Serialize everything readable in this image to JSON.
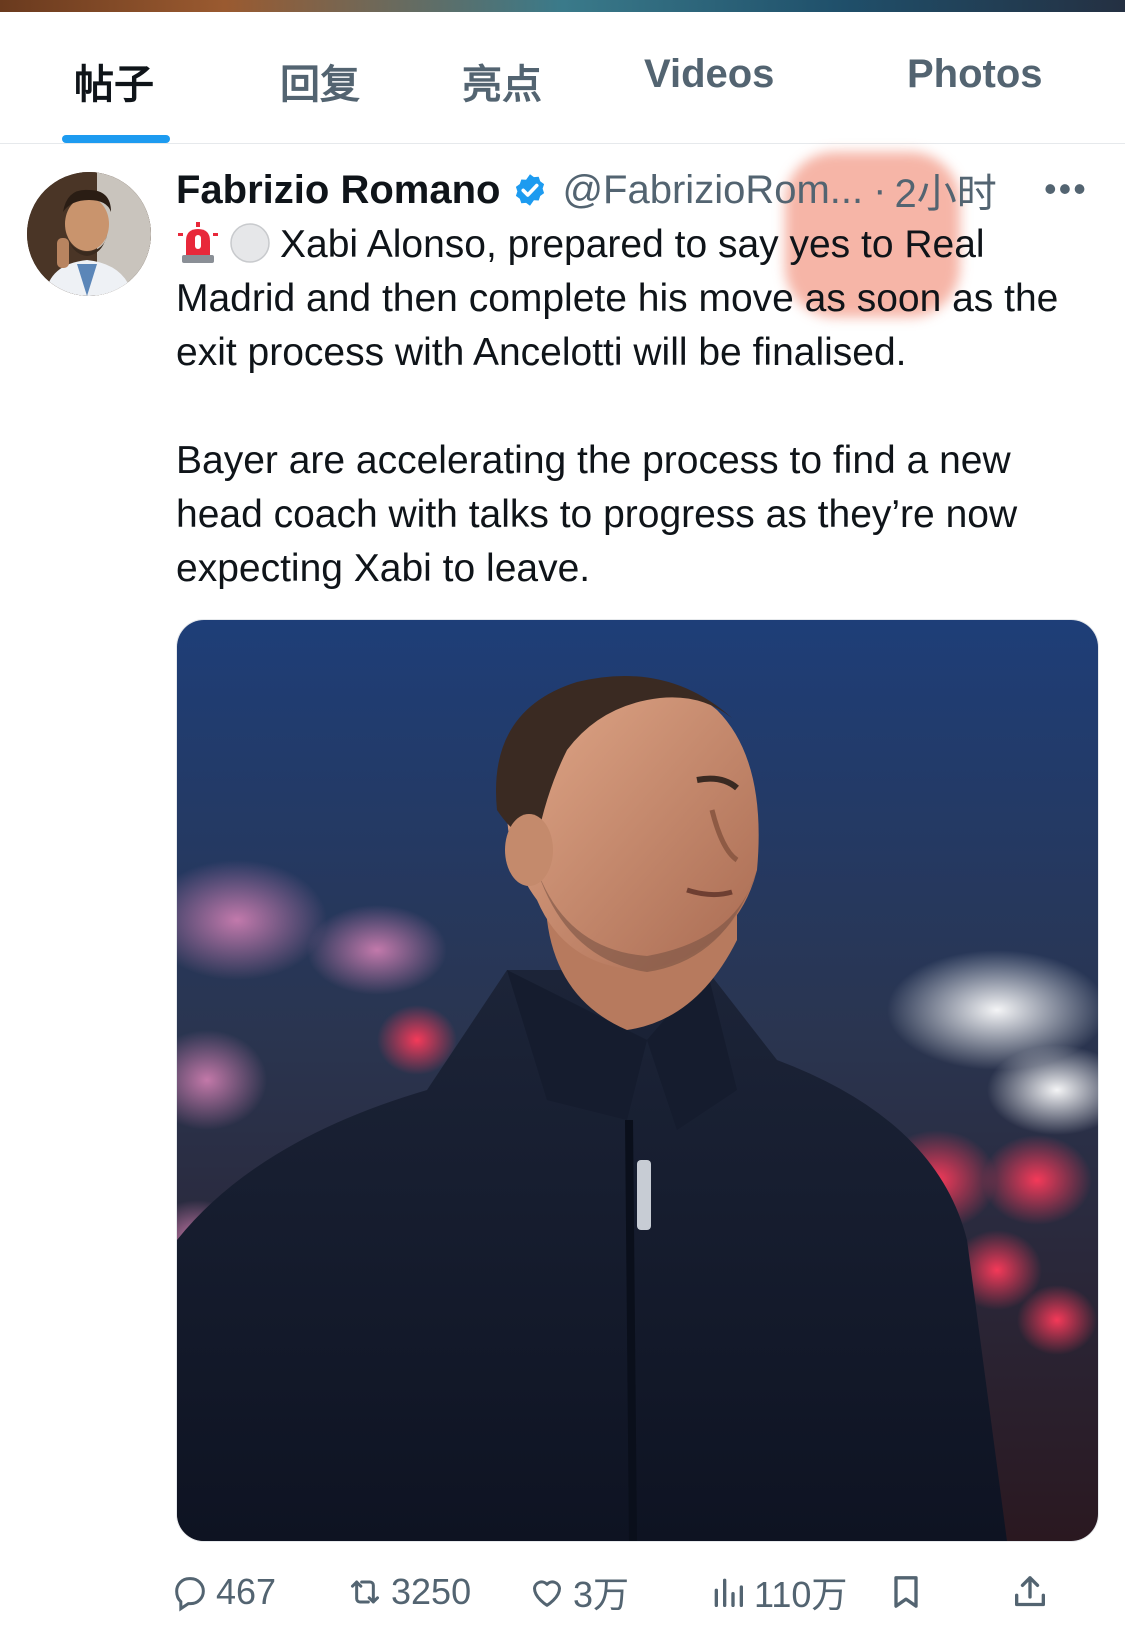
{
  "tabs": [
    {
      "label": "帖子",
      "active": true
    },
    {
      "label": "回复",
      "active": false
    },
    {
      "label": "亮点",
      "active": false
    },
    {
      "label": "Videos",
      "active": false
    },
    {
      "label": "Photos",
      "active": false
    }
  ],
  "tweet": {
    "author_name": "Fabrizio Romano",
    "handle": "@FabrizioRom...",
    "time_separator": "·",
    "time": "2小时",
    "more_label": "•••",
    "paragraph_1": "Xabi Alonso, prepared to say yes to Real Madrid and then complete his move as soon as the exit process with Ancelotti will be finalised.",
    "paragraph_2": "Bayer are accelerating the process to find a new head coach with talks to progress as they’re now expecting Xabi to leave.",
    "emoji_icons": [
      "rotating-light-icon",
      "white-circle-icon"
    ]
  },
  "actions": {
    "replies": "467",
    "reposts": "3250",
    "likes": "3万",
    "views": "110万"
  },
  "colors": {
    "accent": "#1d9bf0",
    "text_primary": "#0f1419",
    "text_secondary": "#536471"
  }
}
